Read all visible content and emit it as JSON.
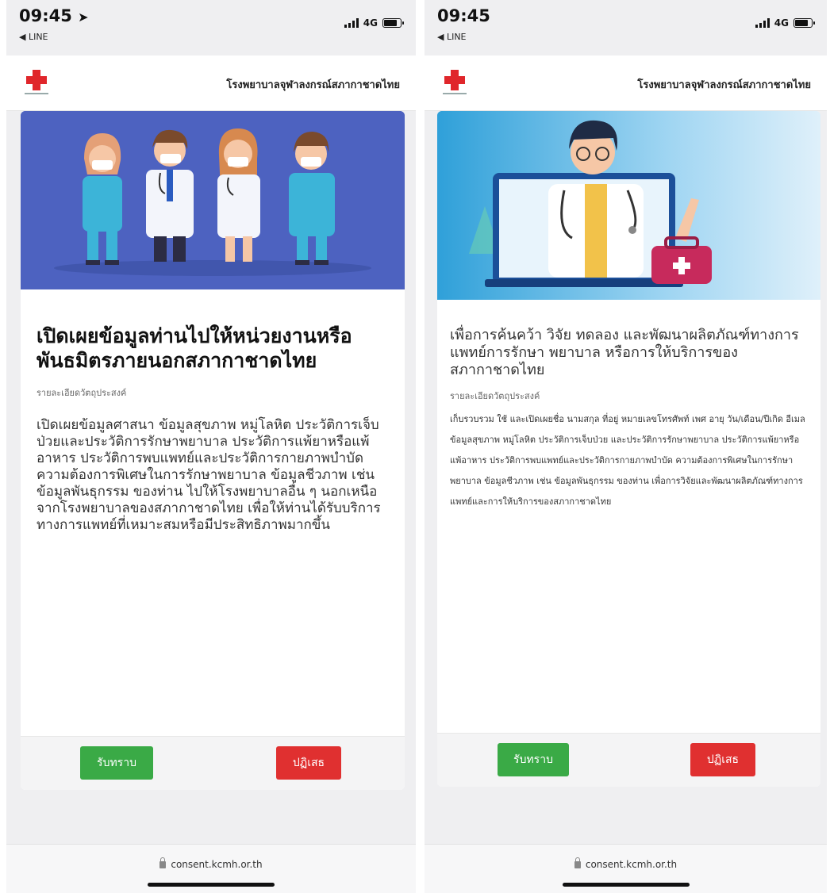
{
  "colors": {
    "accept": "#3aaa46",
    "reject": "#e03030",
    "hero_left": "#4e63c1",
    "hero_right": "#2f9fd8"
  },
  "screens": [
    {
      "status": {
        "time": "09:45",
        "back_app": "◀ LINE",
        "network": "4G"
      },
      "header": {
        "hospital_name": "โรงพยาบาลจุฬาลงกรณ์สภากาชาดไทย"
      },
      "card": {
        "title": "เปิดเผยข้อมูลท่านไปให้หน่วยงานหรือพันธมิตรภายนอกสภากาชาดไทย",
        "subtitle": "รายละเอียดวัตถุประสงค์",
        "description": "เปิดเผยข้อมูลศาสนา ข้อมูลสุขภาพ หมู่โลหิต ประวัติการเจ็บป่วยและประวัติการรักษาพยาบาล ประวัติการแพ้ยาหรือแพ้อาหาร ประวัติการพบแพทย์และประวัติการกายภาพบำบัด ความต้องการพิเศษในการรักษาพยาบาล ข้อมูลชีวภาพ เช่น ข้อมูลพันธุกรรม ของท่าน ไปให้โรงพยาบาลอื่น ๆ นอกเหนือจากโรงพยาบาลของสภากาชาดไทย เพื่อให้ท่านได้รับบริการทางการแพทย์ที่เหมาะสมหรือมีประสิทธิภาพมากขึ้น",
        "accept_label": "รับทราบ",
        "reject_label": "ปฏิเสธ"
      },
      "url": "consent.kcmh.or.th"
    },
    {
      "status": {
        "time": "09:45",
        "back_app": "◀ LINE",
        "network": "4G"
      },
      "header": {
        "hospital_name": "โรงพยาบาลจุฬาลงกรณ์สภากาชาดไทย"
      },
      "card": {
        "title": "เพื่อการค้นคว้า วิจัย ทดลอง และพัฒนาผลิตภัณฑ์ทางการ แพทย์การรักษา พยาบาล หรือการให้บริการของสภากาชาดไทย",
        "subtitle": "รายละเอียดวัตถุประสงค์",
        "description": "เก็บรวบรวม ใช้ และเปิดเผยชื่อ นามสกุล ที่อยู่ หมายเลขโทรศัพท์ เพศ อายุ วัน/เดือน/ปีเกิด อีเมล ข้อมูลสุขภาพ หมู่โลหิต ประวัติการเจ็บป่วย และประวัติการรักษาพยาบาล ประวัติการแพ้ยาหรือแพ้อาหาร ประวัติการพบแพทย์และประวัติการกายภาพบำบัด ความต้องการพิเศษในการรักษาพยาบาล ข้อมูลชีวภาพ เช่น ข้อมูลพันธุกรรม ของท่าน เพื่อการวิจัยและพัฒนาผลิตภัณฑ์ทางการแพทย์และการให้บริการของสภากาชาดไทย",
        "accept_label": "รับทราบ",
        "reject_label": "ปฏิเสธ"
      },
      "url": "consent.kcmh.or.th"
    }
  ]
}
